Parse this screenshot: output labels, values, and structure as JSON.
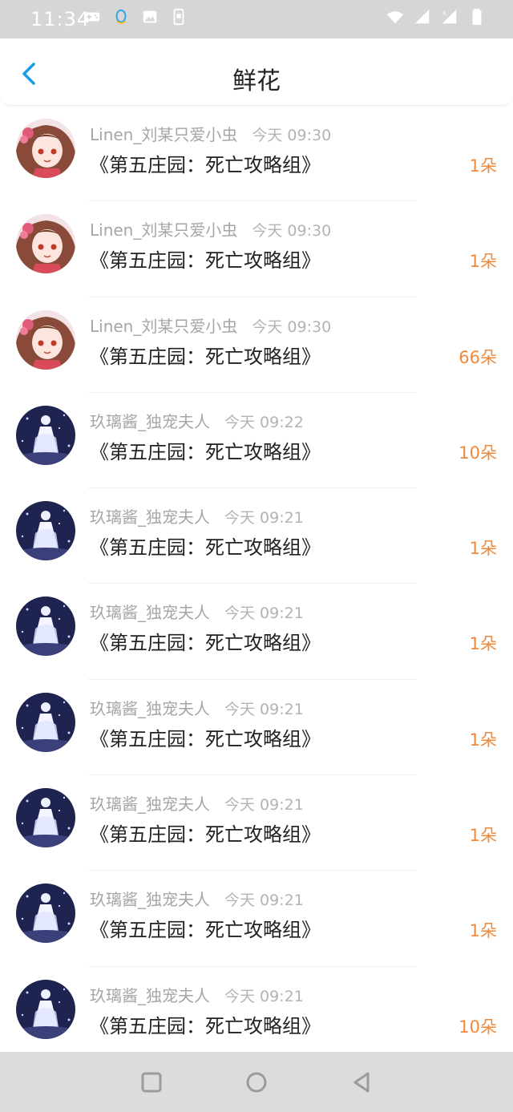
{
  "status_bar": {
    "time": "11:34",
    "left_icons": [
      "gamepad-icon",
      "qq-icon",
      "image-icon",
      "sim-icon"
    ],
    "right_icons": [
      "wifi-icon",
      "signal-icon",
      "signal-x-icon",
      "battery-icon"
    ]
  },
  "header": {
    "title": "鲜花",
    "back_icon": "chevron-left-icon",
    "accent_color": "#1a9be6"
  },
  "colors": {
    "count_color": "#f0893a",
    "meta_color": "#a6a6a6"
  },
  "items": [
    {
      "user": "Linen_刘某只爱小虫",
      "time": "今天 09:30",
      "title": "《第五庄园：死亡攻略组》",
      "count": "1朵",
      "avatar": "avatar-girl-pink"
    },
    {
      "user": "Linen_刘某只爱小虫",
      "time": "今天 09:30",
      "title": "《第五庄园：死亡攻略组》",
      "count": "1朵",
      "avatar": "avatar-girl-pink"
    },
    {
      "user": "Linen_刘某只爱小虫",
      "time": "今天 09:30",
      "title": "《第五庄园：死亡攻略组》",
      "count": "66朵",
      "avatar": "avatar-girl-pink"
    },
    {
      "user": "玖璃酱_独宠夫人",
      "time": "今天 09:22",
      "title": "《第五庄园：死亡攻略组》",
      "count": "10朵",
      "avatar": "avatar-night-figure"
    },
    {
      "user": "玖璃酱_独宠夫人",
      "time": "今天 09:21",
      "title": "《第五庄园：死亡攻略组》",
      "count": "1朵",
      "avatar": "avatar-night-figure"
    },
    {
      "user": "玖璃酱_独宠夫人",
      "time": "今天 09:21",
      "title": "《第五庄园：死亡攻略组》",
      "count": "1朵",
      "avatar": "avatar-night-figure"
    },
    {
      "user": "玖璃酱_独宠夫人",
      "time": "今天 09:21",
      "title": "《第五庄园：死亡攻略组》",
      "count": "1朵",
      "avatar": "avatar-night-figure"
    },
    {
      "user": "玖璃酱_独宠夫人",
      "time": "今天 09:21",
      "title": "《第五庄园：死亡攻略组》",
      "count": "1朵",
      "avatar": "avatar-night-figure"
    },
    {
      "user": "玖璃酱_独宠夫人",
      "time": "今天 09:21",
      "title": "《第五庄园：死亡攻略组》",
      "count": "1朵",
      "avatar": "avatar-night-figure"
    },
    {
      "user": "玖璃酱_独宠夫人",
      "time": "今天 09:21",
      "title": "《第五庄园：死亡攻略组》",
      "count": "10朵",
      "avatar": "avatar-night-figure"
    }
  ],
  "nav_bar": {
    "buttons": [
      "recents-square-icon",
      "home-circle-icon",
      "back-triangle-icon"
    ]
  }
}
